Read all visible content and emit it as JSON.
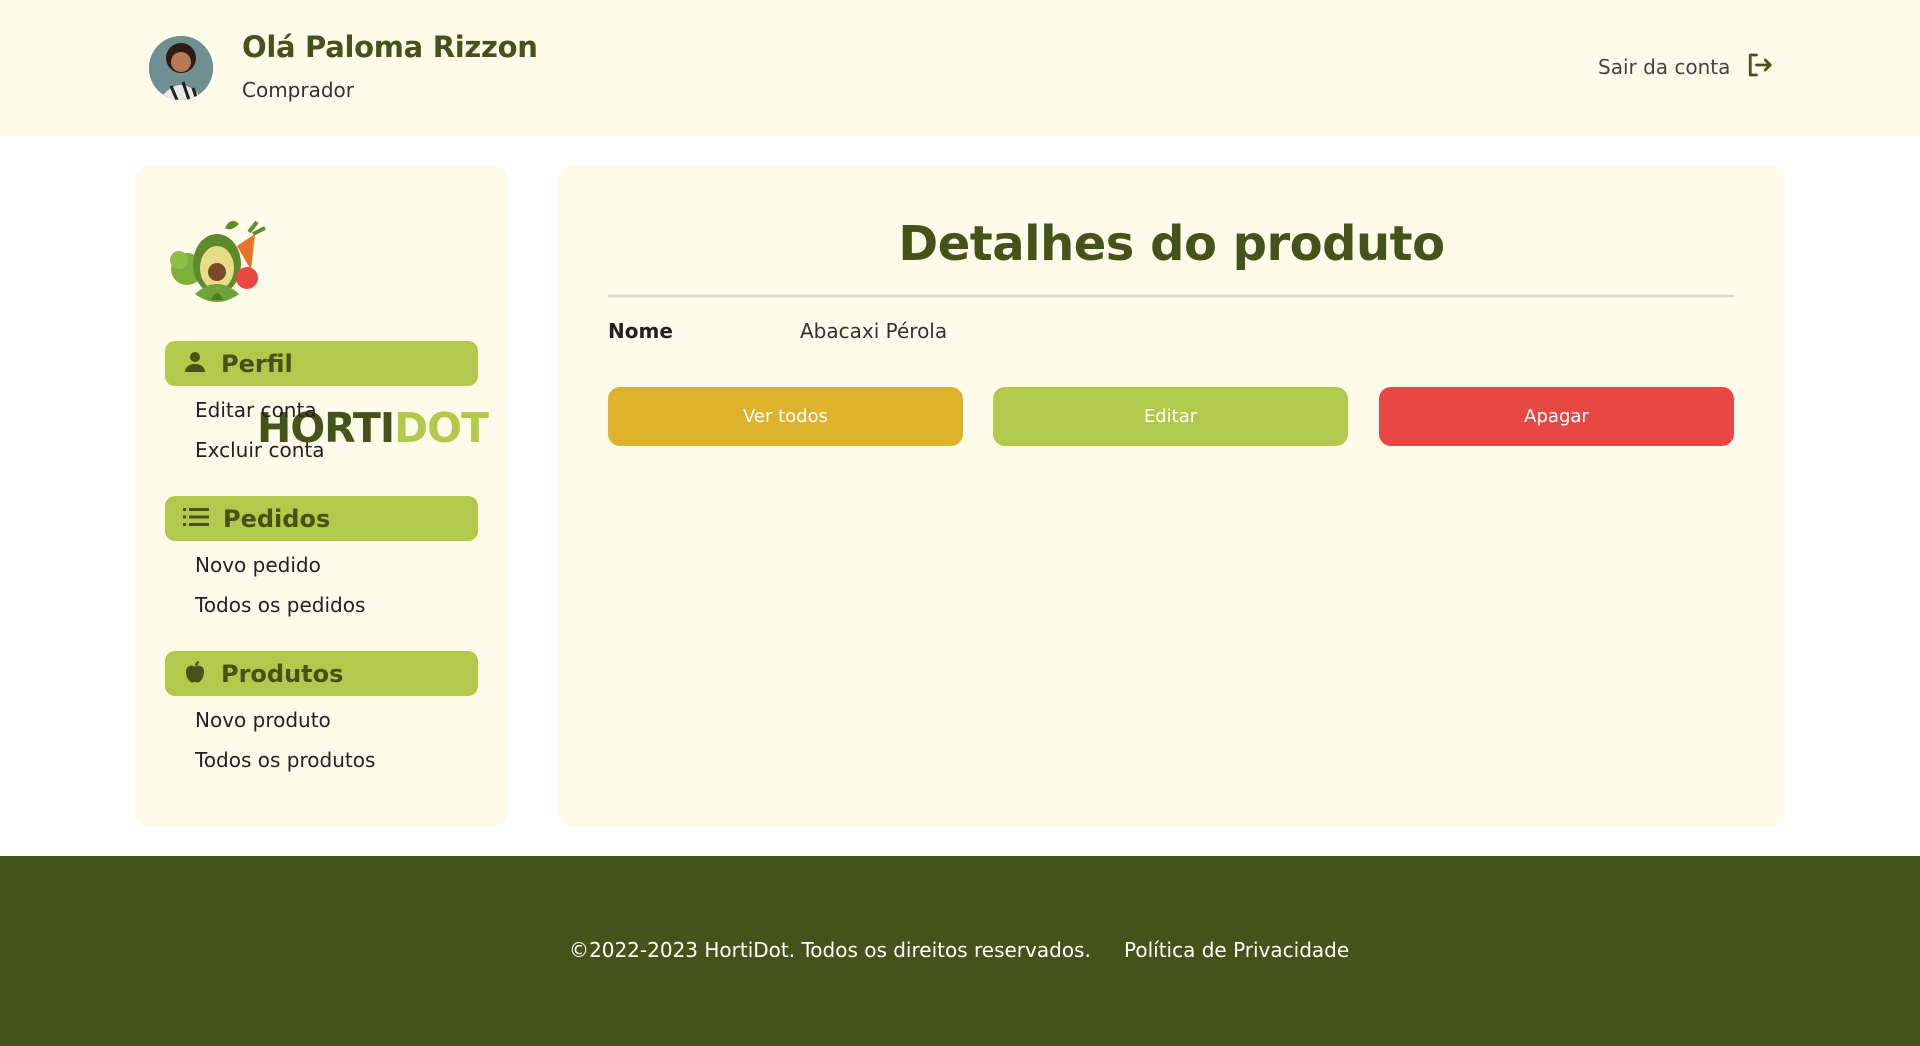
{
  "header": {
    "greeting": "Olá Paloma Rizzon",
    "role": "Comprador",
    "logout_label": "Sair da conta"
  },
  "sidebar": {
    "logo": {
      "part1": "HORTI",
      "part2": "DOT"
    },
    "sections": [
      {
        "label": "Perfil",
        "icon": "person-icon",
        "links": [
          "Editar conta",
          "Excluir conta"
        ]
      },
      {
        "label": "Pedidos",
        "icon": "list-icon",
        "links": [
          "Novo pedido",
          "Todos os pedidos"
        ]
      },
      {
        "label": "Produtos",
        "icon": "apple-icon",
        "links": [
          "Novo produto",
          "Todos os produtos"
        ]
      }
    ]
  },
  "main": {
    "title": "Detalhes do produto",
    "field": {
      "label": "Nome",
      "value": "Abacaxi Pérola"
    },
    "buttons": {
      "all": "Ver todos",
      "edit": "Editar",
      "delete": "Apagar"
    }
  },
  "footer": {
    "copyright": "©2022-2023 HortiDot. Todos os direitos reservados.",
    "privacy": "Política de Privacidade"
  },
  "colors": {
    "primary_dark": "#44531a",
    "accent_green": "#b2c94b",
    "accent_yellow": "#dfb22c",
    "danger_red": "#e84744",
    "panel_bg": "#fffbea"
  }
}
